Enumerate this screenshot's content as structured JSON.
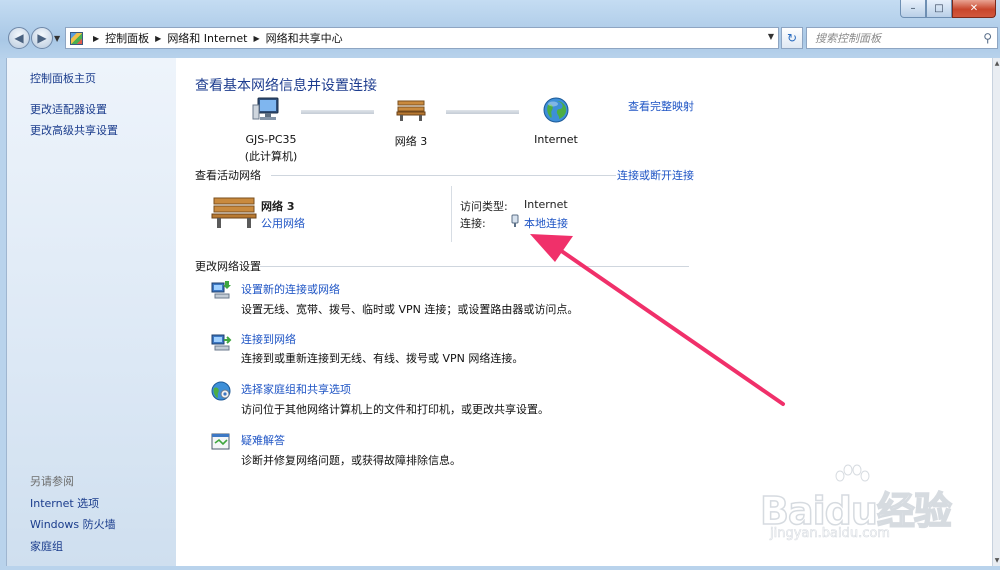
{
  "window": {
    "minimize": "–",
    "maximize": "□",
    "close": "✕"
  },
  "nav": {
    "back_icon": "back-arrow-icon",
    "forward_icon": "forward-arrow-icon",
    "breadcrumbs": [
      "控制面板",
      "网络和 Internet",
      "网络和共享中心"
    ],
    "search_placeholder": "搜索控制面板"
  },
  "sidebar": {
    "home": "控制面板主页",
    "links": [
      "更改适配器设置",
      "更改高级共享设置"
    ],
    "see_also_title": "另请参阅",
    "see_also": [
      "Internet 选项",
      "Windows 防火墙",
      "家庭组"
    ]
  },
  "main": {
    "title": "查看基本网络信息并设置连接",
    "view_full_map": "查看完整映射",
    "map": {
      "computer_name": "GJS-PC35",
      "computer_sub": "(此计算机)",
      "network_name": "网络  3",
      "internet": "Internet"
    },
    "active_networks": {
      "heading": "查看活动网络",
      "connect_disconnect": "连接或断开连接",
      "network_name": "网络  3",
      "network_type": "公用网络",
      "access_type_label": "访问类型:",
      "access_type_value": "Internet",
      "connections_label": "连接:",
      "connection_value": "本地连接"
    },
    "change_settings": {
      "heading": "更改网络设置",
      "tasks": [
        {
          "title": "设置新的连接或网络",
          "desc": "设置无线、宽带、拨号、临时或 VPN 连接；或设置路由器或访问点。",
          "icon": "new-connection-icon"
        },
        {
          "title": "连接到网络",
          "desc": "连接到或重新连接到无线、有线、拨号或 VPN 网络连接。",
          "icon": "connect-network-icon"
        },
        {
          "title": "选择家庭组和共享选项",
          "desc": "访问位于其他网络计算机上的文件和打印机，或更改共享设置。",
          "icon": "homegroup-icon"
        },
        {
          "title": "疑难解答",
          "desc": "诊断并修复网络问题，或获得故障排除信息。",
          "icon": "troubleshoot-icon"
        }
      ]
    }
  },
  "annotation": {
    "arrow_color": "#f0306a"
  },
  "watermark": {
    "brand": "Baidu经验",
    "url": "jingyan.baidu.com"
  }
}
